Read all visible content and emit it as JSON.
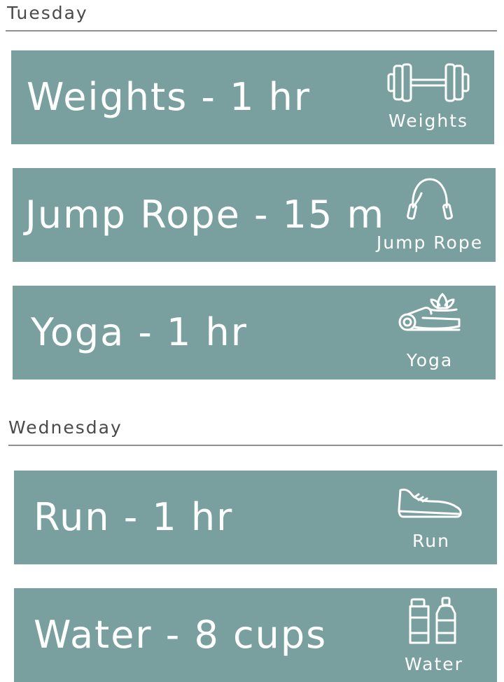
{
  "sections": [
    {
      "day": "Tuesday",
      "items": [
        {
          "title": "Weights - 1 hr",
          "icon": "dumbbell-icon",
          "icon_label": "Weights"
        },
        {
          "title": "Jump Rope - 15 m",
          "icon": "jump-rope-icon",
          "icon_label": "Jump Rope"
        },
        {
          "title": "Yoga - 1 hr",
          "icon": "yoga-mat-lotus-icon",
          "icon_label": "Yoga"
        }
      ]
    },
    {
      "day": "Wednesday",
      "items": [
        {
          "title": "Run - 1 hr",
          "icon": "sneaker-icon",
          "icon_label": "Run"
        },
        {
          "title": "Water - 8 cups",
          "icon": "water-bottles-icon",
          "icon_label": "Water"
        }
      ]
    }
  ],
  "colors": {
    "card_background": "#79a09f",
    "card_text": "#ffffff",
    "header_text": "#4a4a4a",
    "divider": "#8f8f8f"
  }
}
